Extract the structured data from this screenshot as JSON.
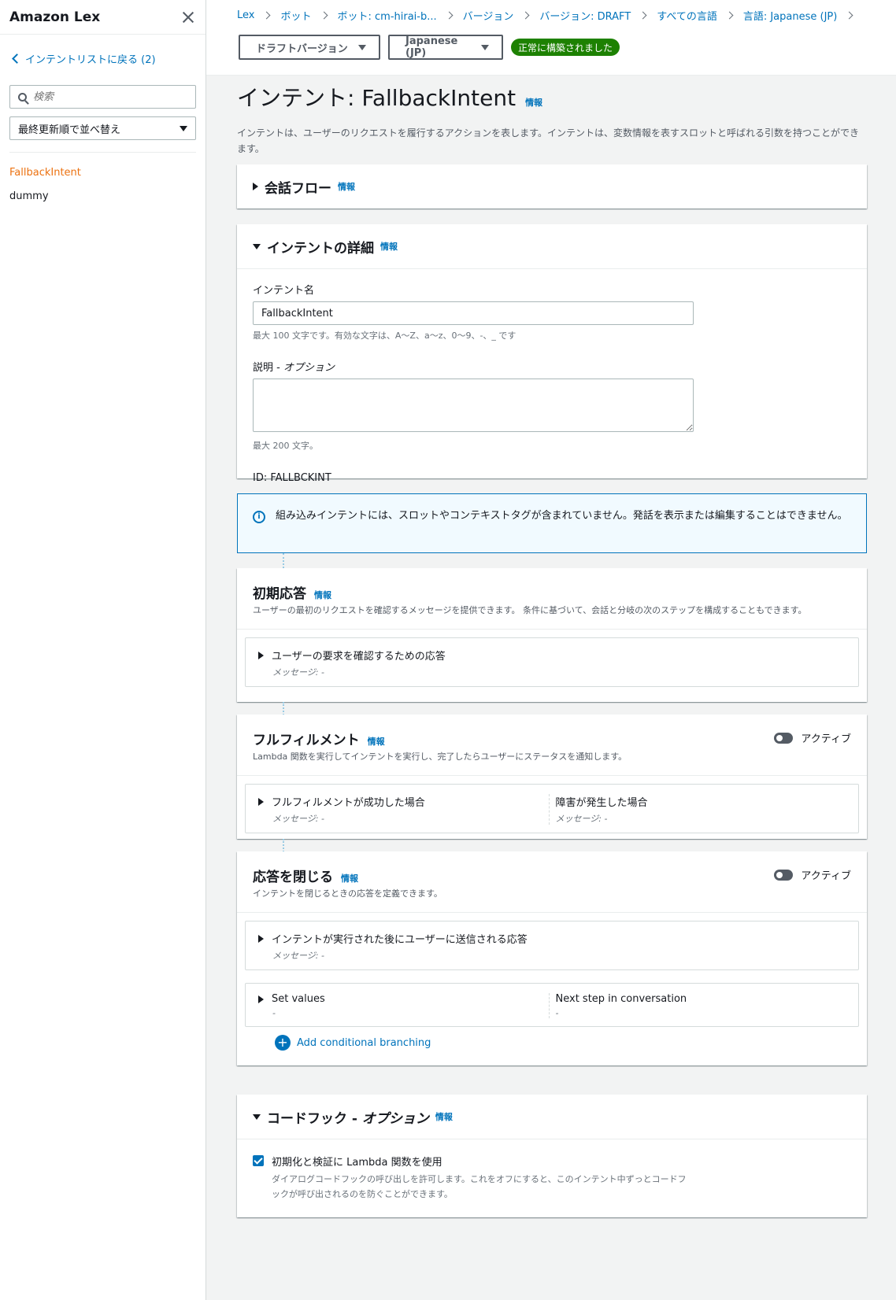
{
  "sidebar": {
    "title": "Amazon Lex",
    "back_link": "インテントリストに戻る (2)",
    "search_placeholder": "検索",
    "sort_select": "最終更新順で並べ替え",
    "items": [
      {
        "label": "FallbackIntent",
        "active": true
      },
      {
        "label": "dummy",
        "active": false
      }
    ]
  },
  "breadcrumbs": [
    "Lex",
    "ボット",
    "ボット: cm-hirai-b...",
    "バージョン",
    "バージョン: DRAFT",
    "すべての言語",
    "言語: Japanese (JP)"
  ],
  "header": {
    "version_select": "ドラフトバージョン",
    "language_select": "Japanese (JP)",
    "status_badge": "正常に構築されました"
  },
  "page": {
    "title": "インテント: FallbackIntent",
    "info": "情報",
    "description": "インテントは、ユーザーのリクエストを履行するアクションを表します。インテントは、変数情報を表すスロットと呼ばれる引数を持つことができます。"
  },
  "conversation_flow": {
    "title": "会話フロー",
    "info": "情報"
  },
  "intent_details": {
    "title": "インテントの詳細",
    "info": "情報",
    "name_label": "インテント名",
    "name_value": "FallbackIntent",
    "name_hint": "最大 100 文字です。有効な文字は、A〜Z、a〜z、0〜9、-、_ です",
    "desc_label": "説明 - ",
    "desc_label_opt": "オプション",
    "desc_hint": "最大 200 文字。",
    "id_text": "ID: FALLBCKINT"
  },
  "alert": {
    "text": "組み込みインテントには、スロットやコンテキストタグが含まれていません。発話を表示または編集することはできません。"
  },
  "initial_response": {
    "title": "初期応答",
    "info": "情報",
    "description": "ユーザーの最初のリクエストを確認するメッセージを提供できます。 条件に基づいて、会話と分岐の次のステップを構成することもできます。",
    "card_title": "ユーザーの要求を確認するための応答",
    "card_sub": "メッセージ: -"
  },
  "fulfillment": {
    "title": "フルフィルメント",
    "info": "情報",
    "description": "Lambda 関数を実行してインテントを実行し、完了したらユーザーにステータスを通知します。",
    "toggle_label": "アクティブ",
    "success_title": "フルフィルメントが成功した場合",
    "success_sub": "メッセージ: -",
    "failure_title": "障害が発生した場合",
    "failure_sub": "メッセージ: -"
  },
  "closing_response": {
    "title": "応答を閉じる",
    "info": "情報",
    "description": "インテントを閉じるときの応答を定義できます。",
    "toggle_label": "アクティブ",
    "card_title": "インテントが実行された後にユーザーに送信される応答",
    "card_sub": "メッセージ: -",
    "set_values": "Set values",
    "set_values_sub": "-",
    "next_step": "Next step in conversation",
    "next_step_sub": "-",
    "add_branch": "Add conditional branching"
  },
  "code_hooks": {
    "title": "コードフック - ",
    "title_opt": "オプション",
    "info": "情報",
    "checkbox_label": "初期化と検証に Lambda 関数を使用",
    "checkbox_checked": true,
    "checkbox_desc": "ダイアログコードフックの呼び出しを許可します。これをオフにすると、このインテント中ずっとコードフックが呼び出されるのを防ぐことができます。"
  }
}
